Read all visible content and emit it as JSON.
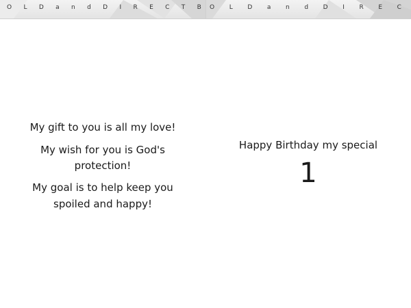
{
  "header": {
    "left_letters": [
      "O",
      "L",
      "D",
      "a",
      "n",
      "d",
      "D",
      "I",
      "R",
      "E",
      "C",
      "T",
      "B"
    ],
    "right_letters": [
      "O",
      "L",
      "D",
      "a",
      "n",
      "d",
      "D",
      "I",
      "R",
      "E",
      "C"
    ]
  },
  "left_page": {
    "line1": "My gift to you is all my love!",
    "line2a": "My wish for you is God's",
    "line2b": "protection!",
    "line3a": "My goal is to help keep you",
    "line3b": "spoiled and happy!"
  },
  "right_page": {
    "greeting": "Happy Birthday my special",
    "age": "1"
  },
  "colors": {
    "text": "#1a1a1a",
    "banner": "#e8e8e8"
  }
}
